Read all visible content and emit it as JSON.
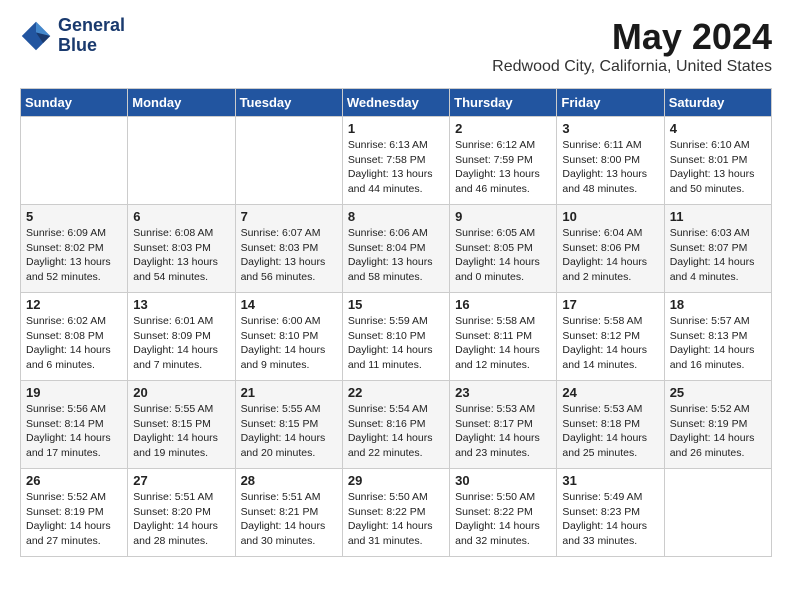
{
  "logo": {
    "line1": "General",
    "line2": "Blue"
  },
  "title": "May 2024",
  "location": "Redwood City, California, United States",
  "weekdays": [
    "Sunday",
    "Monday",
    "Tuesday",
    "Wednesday",
    "Thursday",
    "Friday",
    "Saturday"
  ],
  "weeks": [
    [
      {
        "day": "",
        "info": ""
      },
      {
        "day": "",
        "info": ""
      },
      {
        "day": "",
        "info": ""
      },
      {
        "day": "1",
        "info": "Sunrise: 6:13 AM\nSunset: 7:58 PM\nDaylight: 13 hours\nand 44 minutes."
      },
      {
        "day": "2",
        "info": "Sunrise: 6:12 AM\nSunset: 7:59 PM\nDaylight: 13 hours\nand 46 minutes."
      },
      {
        "day": "3",
        "info": "Sunrise: 6:11 AM\nSunset: 8:00 PM\nDaylight: 13 hours\nand 48 minutes."
      },
      {
        "day": "4",
        "info": "Sunrise: 6:10 AM\nSunset: 8:01 PM\nDaylight: 13 hours\nand 50 minutes."
      }
    ],
    [
      {
        "day": "5",
        "info": "Sunrise: 6:09 AM\nSunset: 8:02 PM\nDaylight: 13 hours\nand 52 minutes."
      },
      {
        "day": "6",
        "info": "Sunrise: 6:08 AM\nSunset: 8:03 PM\nDaylight: 13 hours\nand 54 minutes."
      },
      {
        "day": "7",
        "info": "Sunrise: 6:07 AM\nSunset: 8:03 PM\nDaylight: 13 hours\nand 56 minutes."
      },
      {
        "day": "8",
        "info": "Sunrise: 6:06 AM\nSunset: 8:04 PM\nDaylight: 13 hours\nand 58 minutes."
      },
      {
        "day": "9",
        "info": "Sunrise: 6:05 AM\nSunset: 8:05 PM\nDaylight: 14 hours\nand 0 minutes."
      },
      {
        "day": "10",
        "info": "Sunrise: 6:04 AM\nSunset: 8:06 PM\nDaylight: 14 hours\nand 2 minutes."
      },
      {
        "day": "11",
        "info": "Sunrise: 6:03 AM\nSunset: 8:07 PM\nDaylight: 14 hours\nand 4 minutes."
      }
    ],
    [
      {
        "day": "12",
        "info": "Sunrise: 6:02 AM\nSunset: 8:08 PM\nDaylight: 14 hours\nand 6 minutes."
      },
      {
        "day": "13",
        "info": "Sunrise: 6:01 AM\nSunset: 8:09 PM\nDaylight: 14 hours\nand 7 minutes."
      },
      {
        "day": "14",
        "info": "Sunrise: 6:00 AM\nSunset: 8:10 PM\nDaylight: 14 hours\nand 9 minutes."
      },
      {
        "day": "15",
        "info": "Sunrise: 5:59 AM\nSunset: 8:10 PM\nDaylight: 14 hours\nand 11 minutes."
      },
      {
        "day": "16",
        "info": "Sunrise: 5:58 AM\nSunset: 8:11 PM\nDaylight: 14 hours\nand 12 minutes."
      },
      {
        "day": "17",
        "info": "Sunrise: 5:58 AM\nSunset: 8:12 PM\nDaylight: 14 hours\nand 14 minutes."
      },
      {
        "day": "18",
        "info": "Sunrise: 5:57 AM\nSunset: 8:13 PM\nDaylight: 14 hours\nand 16 minutes."
      }
    ],
    [
      {
        "day": "19",
        "info": "Sunrise: 5:56 AM\nSunset: 8:14 PM\nDaylight: 14 hours\nand 17 minutes."
      },
      {
        "day": "20",
        "info": "Sunrise: 5:55 AM\nSunset: 8:15 PM\nDaylight: 14 hours\nand 19 minutes."
      },
      {
        "day": "21",
        "info": "Sunrise: 5:55 AM\nSunset: 8:15 PM\nDaylight: 14 hours\nand 20 minutes."
      },
      {
        "day": "22",
        "info": "Sunrise: 5:54 AM\nSunset: 8:16 PM\nDaylight: 14 hours\nand 22 minutes."
      },
      {
        "day": "23",
        "info": "Sunrise: 5:53 AM\nSunset: 8:17 PM\nDaylight: 14 hours\nand 23 minutes."
      },
      {
        "day": "24",
        "info": "Sunrise: 5:53 AM\nSunset: 8:18 PM\nDaylight: 14 hours\nand 25 minutes."
      },
      {
        "day": "25",
        "info": "Sunrise: 5:52 AM\nSunset: 8:19 PM\nDaylight: 14 hours\nand 26 minutes."
      }
    ],
    [
      {
        "day": "26",
        "info": "Sunrise: 5:52 AM\nSunset: 8:19 PM\nDaylight: 14 hours\nand 27 minutes."
      },
      {
        "day": "27",
        "info": "Sunrise: 5:51 AM\nSunset: 8:20 PM\nDaylight: 14 hours\nand 28 minutes."
      },
      {
        "day": "28",
        "info": "Sunrise: 5:51 AM\nSunset: 8:21 PM\nDaylight: 14 hours\nand 30 minutes."
      },
      {
        "day": "29",
        "info": "Sunrise: 5:50 AM\nSunset: 8:22 PM\nDaylight: 14 hours\nand 31 minutes."
      },
      {
        "day": "30",
        "info": "Sunrise: 5:50 AM\nSunset: 8:22 PM\nDaylight: 14 hours\nand 32 minutes."
      },
      {
        "day": "31",
        "info": "Sunrise: 5:49 AM\nSunset: 8:23 PM\nDaylight: 14 hours\nand 33 minutes."
      },
      {
        "day": "",
        "info": ""
      }
    ]
  ]
}
